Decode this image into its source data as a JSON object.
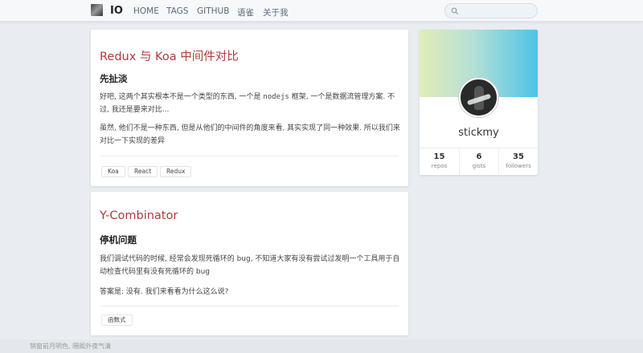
{
  "nav": {
    "brand": "IO",
    "links": [
      "HOME",
      "TAGS",
      "GITHUB",
      "语雀",
      "关于我"
    ],
    "search_placeholder": ""
  },
  "posts": [
    {
      "title": "Redux 与 Koa 中间件对比",
      "subtitle": "先扯淡",
      "p1_a": "好吧, 这两个其实根本不是一个类型的东西, 一个是 ",
      "p1_code": "nodejs",
      "p1_b": " 框架, 一个是数据流管理方案. 不过, 我还是要来对比...",
      "p2": "虽然, 他们不是一种东西, 但是从他们的中间件的角度来看, 其实实现了同一种效果. 所以我们来对比一下实现的差异",
      "tags": [
        "Koa",
        "React",
        "Redux"
      ]
    },
    {
      "title": "Y-Combinator",
      "subtitle": "停机问题",
      "p1": "我们调试代码的时候, 经常会发现死循环的 bug, 不知道大家有没有尝试过发明一个工具用于自动检查代码里有没有死循环的 bug",
      "p2": "答案是: 没有. 我们来看看为什么这么说?",
      "tags": [
        "函数式"
      ]
    }
  ],
  "profile": {
    "username": "stickmy",
    "stats": [
      {
        "value": "15",
        "label": "repos"
      },
      {
        "value": "6",
        "label": "gists"
      },
      {
        "value": "35",
        "label": "followers"
      }
    ]
  },
  "footer": {
    "text": "销窗前月明色, 隔阁外夜气清"
  },
  "colors": {
    "accent_title": "#b13a3a",
    "banner_start": "#e3ecb8",
    "banner_end": "#4ec3e6"
  }
}
